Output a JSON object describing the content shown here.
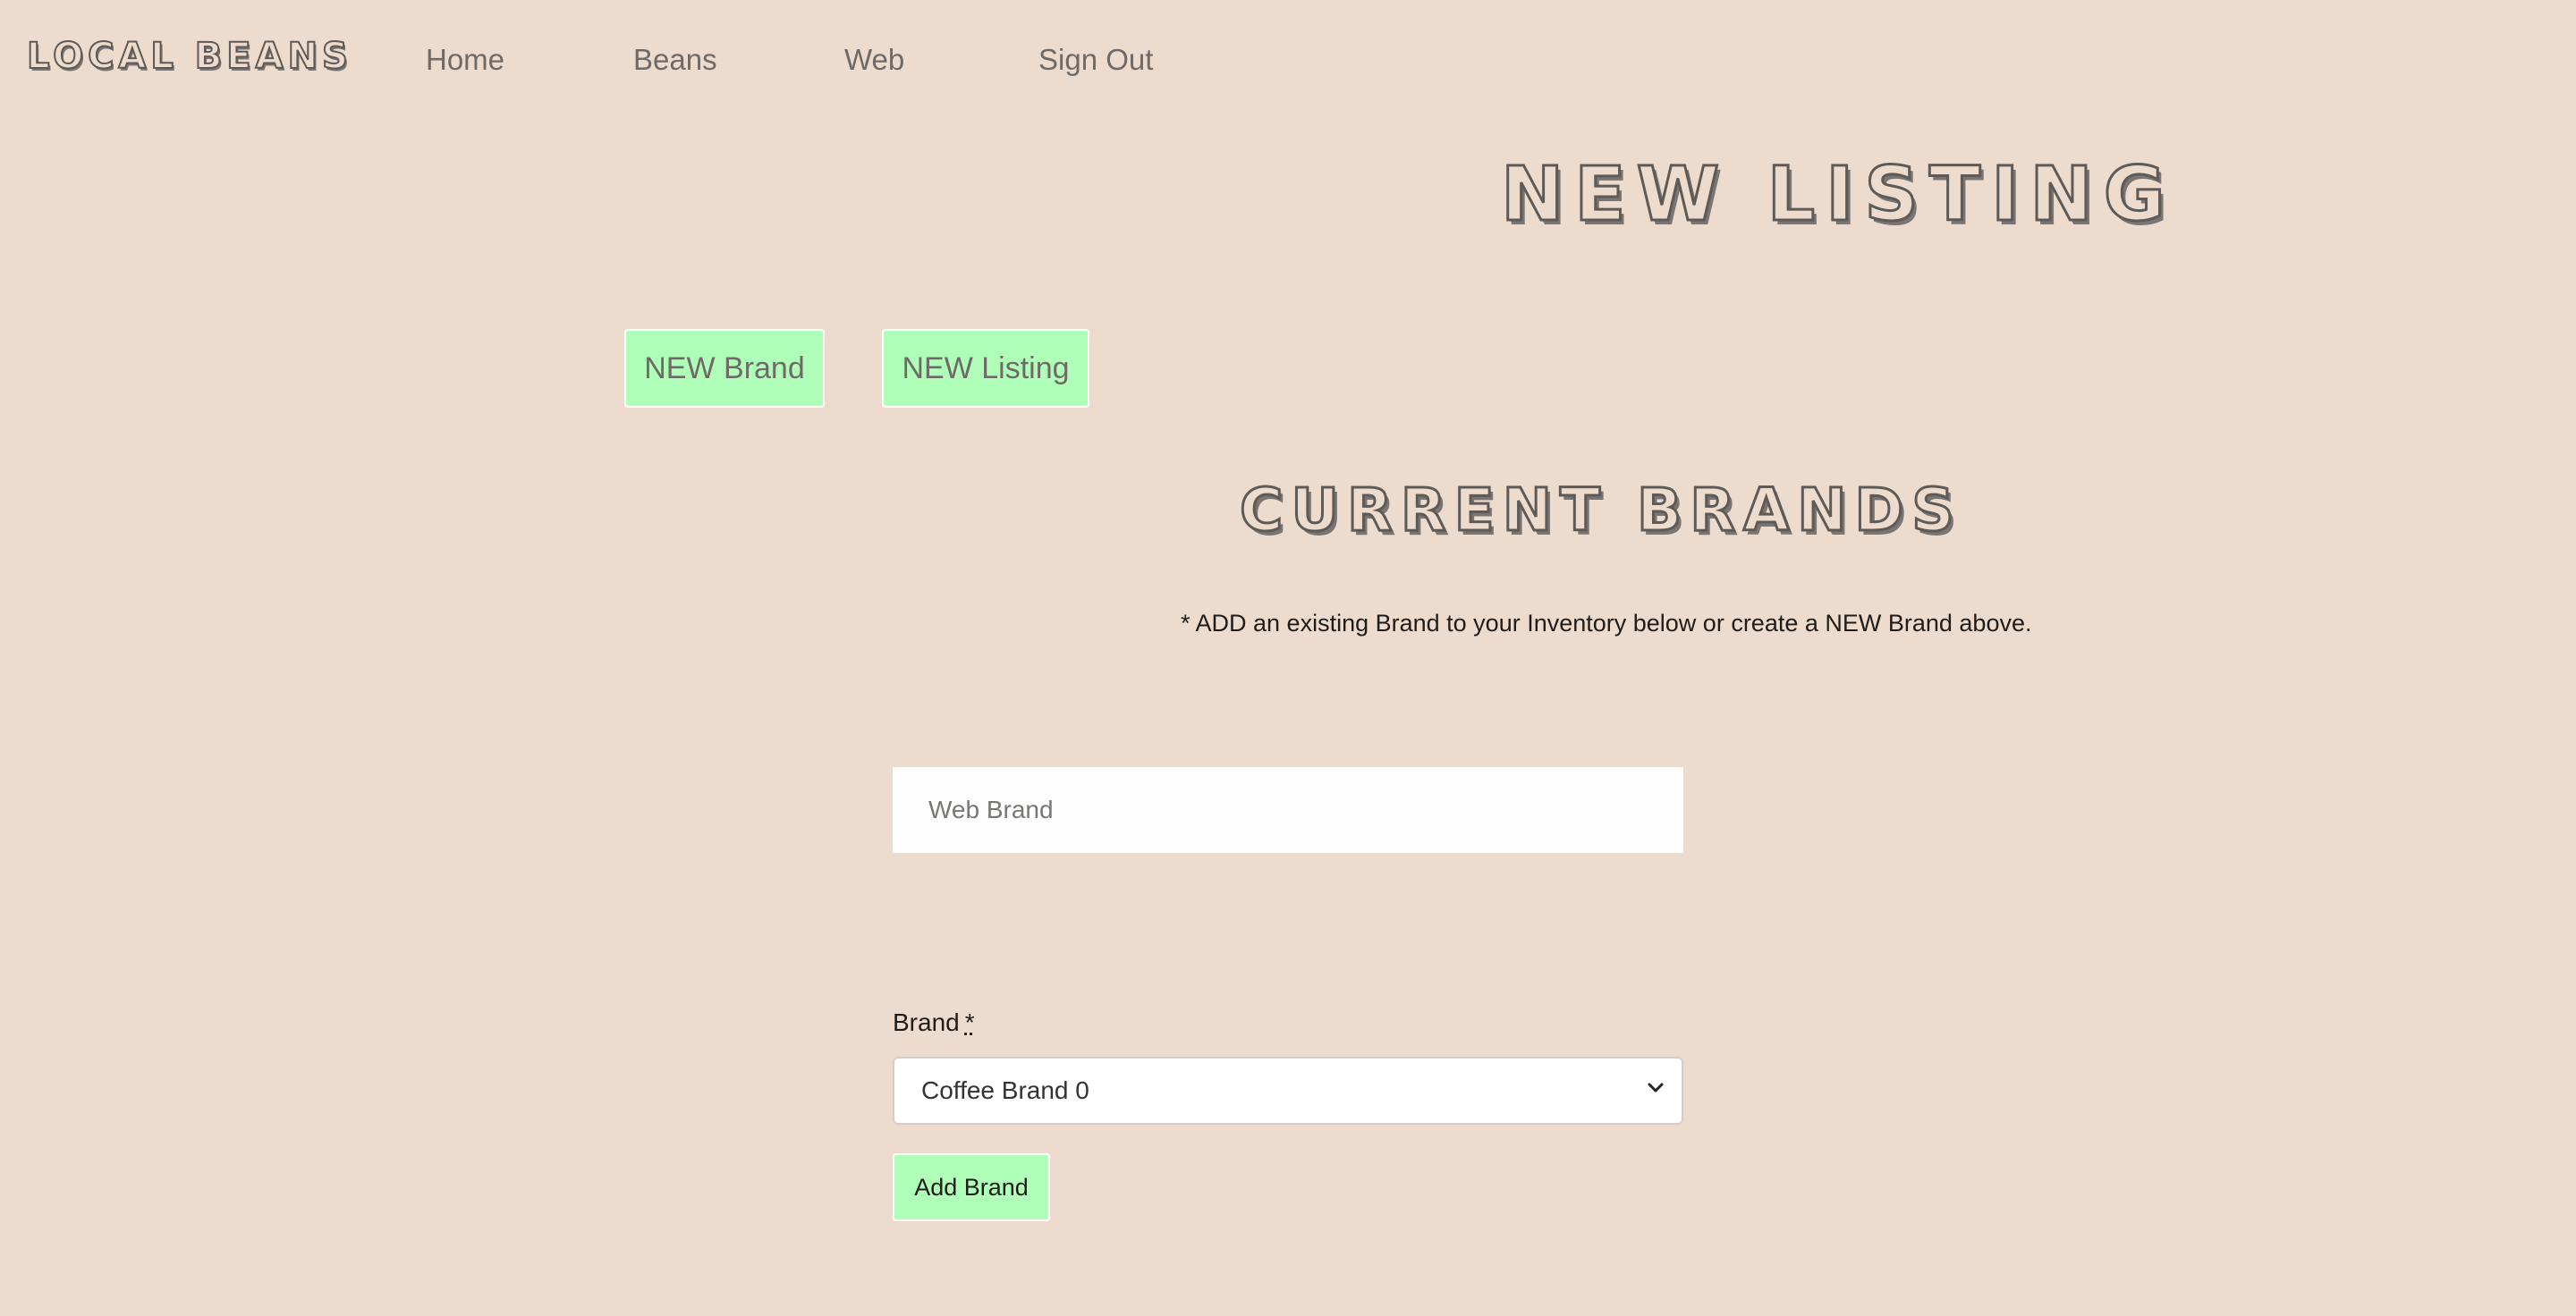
{
  "logo": "LOCAL BEANS",
  "nav": {
    "items": [
      {
        "label": "Home"
      },
      {
        "label": "Beans"
      },
      {
        "label": "Web"
      },
      {
        "label": "Sign Out"
      }
    ]
  },
  "page_heading": "NEW LISTING",
  "actions": {
    "new_brand_label": "NEW Brand",
    "new_listing_label": "NEW Listing"
  },
  "section_heading": "CURRENT BRANDS",
  "instructions": "* ADD an existing Brand to your Inventory below or create a NEW Brand above.",
  "web_brand": {
    "placeholder": "Web Brand",
    "value": ""
  },
  "brand_field": {
    "label": "Brand",
    "required_marker": "*",
    "selected": "Coffee Brand 0"
  },
  "add_brand_label": "Add Brand",
  "colors": {
    "background": "#eddccd",
    "button_green": "#afffb8",
    "text_muted": "#6f6a67",
    "text_dark": "#1f1c1a"
  },
  "icons": {
    "select_chevron": "chevron-down-icon"
  }
}
